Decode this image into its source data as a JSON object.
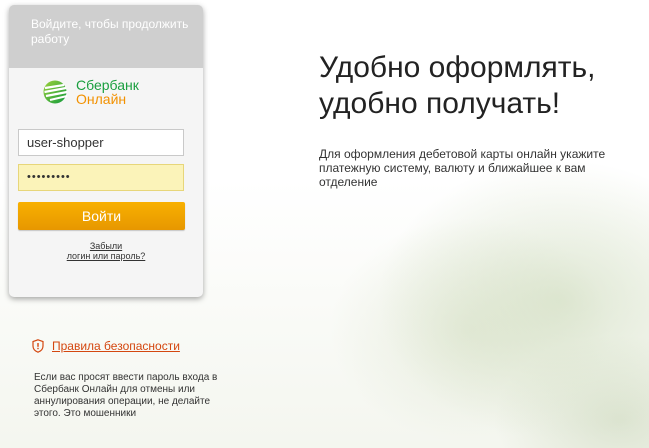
{
  "login_card": {
    "header_text": "Войдите, чтобы продолжить работу",
    "brand_line1": "Сбербанк",
    "brand_line2": "Онлайн",
    "login_value": "user-shopper",
    "password_value": "•••••••••",
    "submit_label": "Войти",
    "forgot_line1": "Забыли",
    "forgot_line2": "логин или пароль?"
  },
  "security": {
    "link_label": "Правила безопасности",
    "note": "Если вас просят ввести пароль входа в Сбербанк Онлайн для отмены или аннулирования операции, не делайте этого. Это мошенники"
  },
  "hero": {
    "title": "Удобно оформлять, удобно получать!",
    "subtitle": "Для оформления дебетовой карты онлайн укажите платежную систему, валюту и ближайшее к вам отделение"
  },
  "colors": {
    "brand_green": "#1a9f3f",
    "brand_orange": "#f29100",
    "button_orange": "#f0a400",
    "link_red": "#d4470f"
  },
  "icons": {
    "logo": "sberbank-logo-icon",
    "security": "shield-icon"
  }
}
